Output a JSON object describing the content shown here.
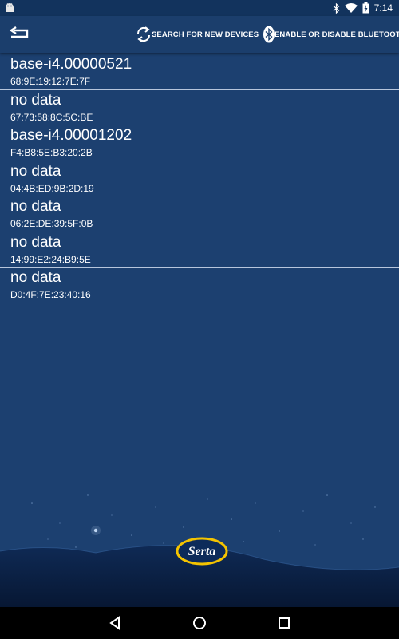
{
  "status_bar": {
    "time": "7:14",
    "icons": [
      "android-icon",
      "bluetooth-icon",
      "wifi-icon",
      "battery-charging-icon"
    ]
  },
  "app_bar": {
    "back_icon": "back-arrow-icon",
    "search_label": "SEARCH FOR NEW DEVICES",
    "search_icon": "refresh-icon",
    "bluetooth_label": "ENABLE OR DISABLE BLUETOOTH",
    "bluetooth_icon": "bluetooth-icon"
  },
  "devices": [
    {
      "name": "base-i4.00000521",
      "mac": "68:9E:19:12:7E:7F"
    },
    {
      "name": "no data",
      "mac": "67:73:58:8C:5C:BE"
    },
    {
      "name": "base-i4.00001202",
      "mac": "F4:B8:5E:B3:20:2B"
    },
    {
      "name": "no data",
      "mac": "04:4B:ED:9B:2D:19"
    },
    {
      "name": "no data",
      "mac": "06:2E:DE:39:5F:0B"
    },
    {
      "name": "no data",
      "mac": "14:99:E2:24:B9:5E"
    },
    {
      "name": "no data",
      "mac": "D0:4F:7E:23:40:16"
    }
  ],
  "brand": {
    "logo_text": "Serta"
  },
  "nav_bar": {
    "icons": [
      "nav-back-icon",
      "nav-home-icon",
      "nav-recents-icon"
    ]
  },
  "colors": {
    "background": "#1c4070",
    "app_bar": "#1b3e6c",
    "divider": "#b7c6dc",
    "logo_ring": "#f5c400"
  }
}
